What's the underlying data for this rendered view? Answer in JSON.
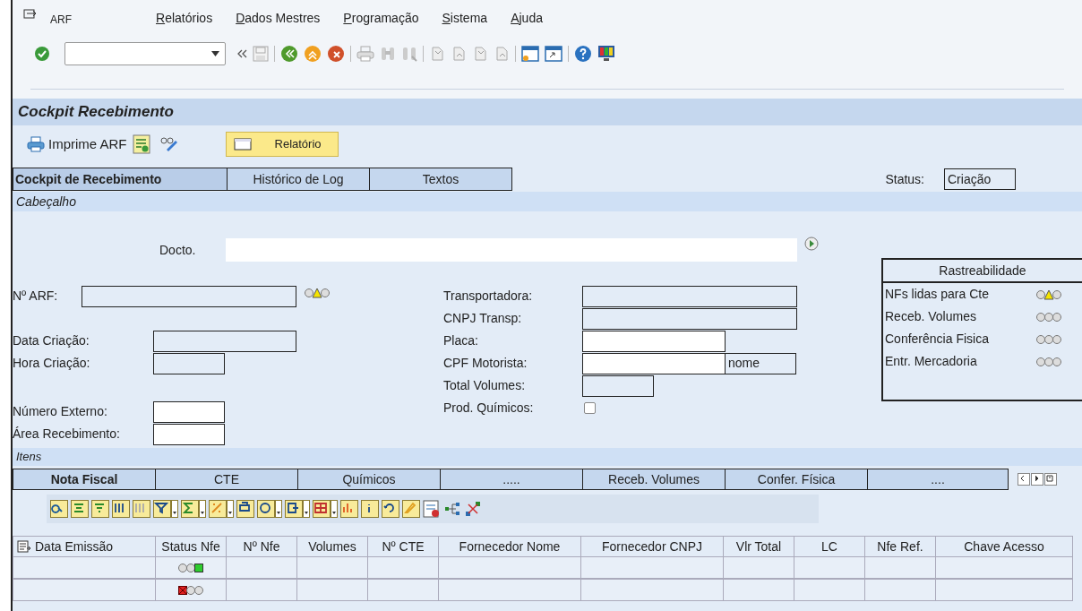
{
  "menu_bar": {
    "title": "ARF",
    "items": [
      "Relatórios",
      "Dados Mestres",
      "Programação",
      "Sistema",
      "Ajuda"
    ]
  },
  "page_title": "Cockpit Recebimento",
  "app_toolbar": {
    "print_button": "Imprime ARF",
    "report_button": "Relatório"
  },
  "tabs": [
    {
      "label": "Cockpit de Recebimento",
      "selected": true
    },
    {
      "label": "Histórico de Log",
      "selected": false
    },
    {
      "label": "Textos",
      "selected": false
    }
  ],
  "status": {
    "label": "Status:",
    "value": "Criação"
  },
  "header_section": "Cabeçalho",
  "document_field": {
    "label": "Docto."
  },
  "left_fields": [
    {
      "label": "Nº ARF:",
      "editable": false,
      "light": {
        "kind": "yellow"
      }
    },
    {
      "label": "Data Criação:",
      "editable": false
    },
    {
      "label": "Hora Criação:",
      "editable": false
    },
    {
      "label": "Número Externo:",
      "editable": true
    },
    {
      "label": "Área Recebimento:",
      "editable": true
    }
  ],
  "right_fields": [
    {
      "label": "Transportadora:",
      "editable": false
    },
    {
      "label": "CNPJ Transp:",
      "editable": false
    },
    {
      "label": "Placa:",
      "editable": true
    },
    {
      "label": "CPF Motorista:",
      "editable": true,
      "suffix": "nome"
    },
    {
      "label": "Total Volumes:",
      "editable": false
    },
    {
      "label": "Prod. Químicos:",
      "kind": "checkbox",
      "checked": false
    }
  ],
  "traceability": {
    "title": "Rastreabilidade",
    "rows": [
      {
        "label": "NFs lidas para Cte",
        "light": {
          "kind": "yellow"
        }
      },
      {
        "label": "Receb. Volumes",
        "light": {
          "kind": "none"
        }
      },
      {
        "label": "Conferência Fisica",
        "light": {
          "kind": "none"
        }
      },
      {
        "label": "Entr. Mercadoria",
        "light": {
          "kind": "none"
        }
      }
    ]
  },
  "items_section": "Itens",
  "item_tabs": [
    {
      "label": "Nota Fiscal",
      "selected": true
    },
    {
      "label": "CTE",
      "selected": false
    },
    {
      "label": "Químicos",
      "selected": false
    },
    {
      "label": ".....",
      "selected": false
    },
    {
      "label": "Receb. Volumes",
      "selected": false
    },
    {
      "label": "Confer. Física",
      "selected": false
    },
    {
      "label": "....",
      "selected": false
    }
  ],
  "table": {
    "columns": [
      "Data Emissão",
      "Status Nfe",
      "Nº Nfe",
      "Volumes",
      "Nº CTE",
      "Fornecedor Nome",
      "Fornecedor CNPJ",
      "Vlr Total",
      "LC",
      "Nfe Ref.",
      "Chave Acesso"
    ],
    "rows": [
      {
        "status_light": {
          "kind": "green"
        }
      },
      {
        "status_light": {
          "kind": "red"
        }
      }
    ]
  }
}
